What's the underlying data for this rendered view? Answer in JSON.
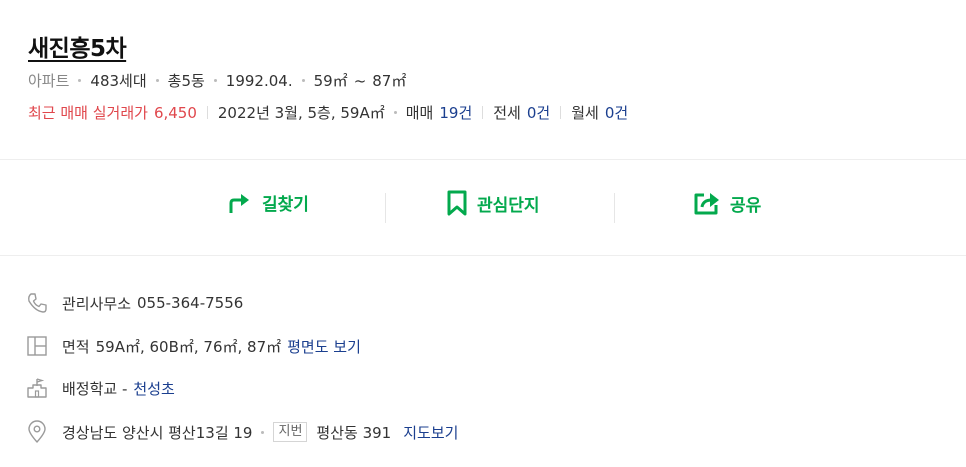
{
  "complex": {
    "name": "새진흥5차",
    "type": "아파트",
    "households": "483세대",
    "buildings": "총5동",
    "approval_date": "1992.04.",
    "area_min": "59㎡",
    "area_tilde": "~",
    "area_max": "87㎡"
  },
  "trade": {
    "recent_label": "최근 매매 실거래가",
    "recent_price": "6,450",
    "recent_detail": "2022년 3월, 5층, 59A㎡",
    "sale_label": "매매",
    "sale_count": "19건",
    "jeonse_label": "전세",
    "jeonse_count": "0건",
    "monthly_label": "월세",
    "monthly_count": "0건"
  },
  "actions": {
    "directions": "길찾기",
    "favorite": "관심단지",
    "share": "공유"
  },
  "info": {
    "office_label": "관리사무소",
    "office_phone": "055-364-7556",
    "area_label": "면적",
    "area_values": "59A㎡, 60B㎡, 76㎡, 87㎡",
    "floorplan_link": "평면도 보기",
    "school_label": "배정학교 -",
    "school_name": "천성초",
    "address": "경상남도 양산시 평산13길 19",
    "lot_tag": "지번",
    "lot_address": "평산동 391",
    "map_link": "지도보기"
  },
  "colors": {
    "accent_green": "#03a94d",
    "price_red": "#e0474c",
    "link_blue": "#1b3f8f"
  },
  "icons": {
    "directions": "turn-right-arrow-icon",
    "favorite": "bookmark-icon",
    "share": "share-icon",
    "phone": "phone-icon",
    "area": "floorplan-icon",
    "school": "school-icon",
    "address": "location-pin-icon"
  }
}
